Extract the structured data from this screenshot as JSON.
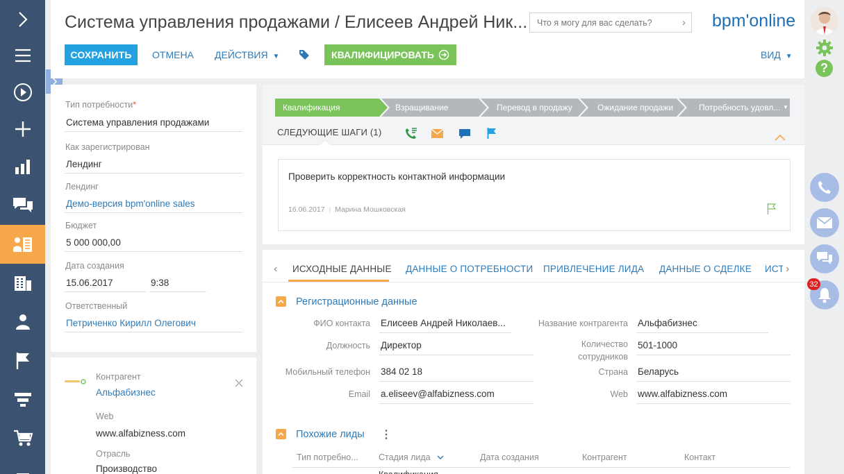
{
  "header": {
    "title": "Система управления продажами / Елисеев Андрей Ник...",
    "search_placeholder": "Что я могу для вас сделать?",
    "logo": "bpm'online",
    "save": "СОХРАНИТЬ",
    "cancel": "ОТМЕНА",
    "actions": "ДЕЙСТВИЯ",
    "qualify": "КВАЛИФИЦИРОВАТЬ",
    "view": "ВИД"
  },
  "nav_icons": [
    "chevron-right-icon",
    "menu-icon",
    "play-icon",
    "plus-icon",
    "bar-chart-icon",
    "chat-icon",
    "leads-icon",
    "accounts-icon",
    "contacts-icon",
    "flag-icon",
    "funnel-icon",
    "cart-icon",
    "doc-icon"
  ],
  "left_fields": {
    "need_type_label": "Тип потребности",
    "need_type_value": "Система управления продажами",
    "registered_label": "Как зарегистрирован",
    "registered_value": "Лендинг",
    "landing_label": "Лендинг",
    "landing_value": "Демо-версия bpm'online sales",
    "budget_label": "Бюджет",
    "budget_value": "5 000 000,00",
    "created_label": "Дата создания",
    "created_date": "15.06.2017",
    "created_time": "9:38",
    "owner_label": "Ответственный",
    "owner_value": "Петриченко Кирилл Олегович"
  },
  "account_card": {
    "account_label": "Контрагент",
    "account_value": "Альфабизнес",
    "web_label": "Web",
    "web_value": "www.alfabizness.com",
    "industry_label": "Отрасль",
    "industry_value": "Производство"
  },
  "stages": [
    "Квалификация",
    "Взращивание",
    "Перевод в продажу",
    "Ожидание продажи",
    "Потребность удовл..."
  ],
  "next_steps": {
    "title": "СЛЕДУЮЩИЕ ШАГИ (1)",
    "task": "Проверить корректность контактной информации",
    "date": "16.06.2017",
    "author": "Марина Мошковская"
  },
  "tabs": [
    "ИСХОДНЫЕ ДАННЫЕ",
    "ДАННЫЕ О ПОТРЕБНОСТИ",
    "ПРИВЛЕЧЕНИЕ ЛИДА",
    "ДАННЫЕ О СДЕЛКЕ",
    "ИСТО"
  ],
  "registration": {
    "section_title": "Регистрационные данные",
    "contact_name_label": "ФИО контакта",
    "contact_name_value": "Елисеев Андрей Николаев...",
    "position_label": "Должность",
    "position_value": "Директор",
    "mobile_label": "Мобильный телефон",
    "mobile_value": "384 02 18",
    "email_label": "Email",
    "email_value": "a.eliseev@alfabizness.com",
    "account_name_label": "Название контрагента",
    "account_name_value": "Альфабизнес",
    "employees_label_1": "Количество",
    "employees_label_2": "сотрудников",
    "employees_value": "501-1000",
    "country_label": "Страна",
    "country_value": "Беларусь",
    "web_label": "Web",
    "web_value": "www.alfabizness.com"
  },
  "similar": {
    "section_title": "Похожие лиды",
    "columns": [
      "Тип потребно...",
      "Стадия лида",
      "Дата создания",
      "Контрагент",
      "Контакт"
    ],
    "first_cell": "Квалификация"
  },
  "notifications_count": "32",
  "colors": {
    "nav": "#3b5270",
    "accent": "#f6a74a",
    "primary": "#23a1e0",
    "green": "#7ac35a",
    "link": "#2e7ab7"
  }
}
